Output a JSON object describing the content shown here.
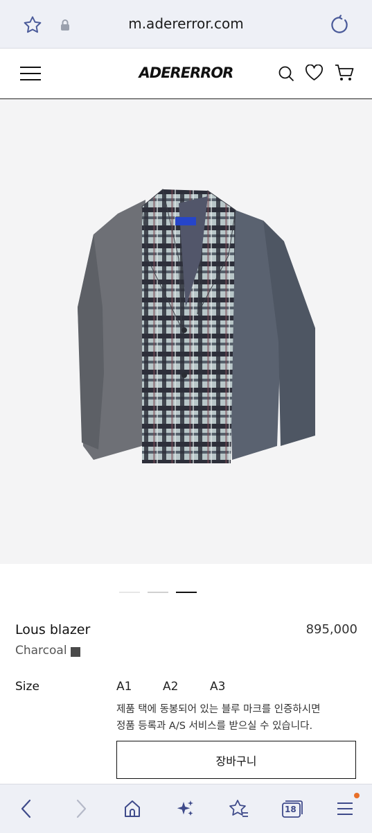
{
  "browser": {
    "url": "m.adererror.com",
    "icons": {
      "bookmark": "star-icon",
      "secure": "lock-icon",
      "reload": "reload-icon"
    },
    "tab_count": "18"
  },
  "header": {
    "logo": "ADERERROR",
    "icons": [
      "menu-icon",
      "search-icon",
      "heart-icon",
      "cart-icon"
    ]
  },
  "gallery": {
    "image_alt": "Lous blazer",
    "active_index": 3,
    "total": 3
  },
  "product": {
    "name": "Lous blazer",
    "price": "895,000",
    "color": "Charcoal",
    "color_hex": "#4a4a4a",
    "size_label": "Size",
    "sizes": [
      "A1",
      "A2",
      "A3"
    ],
    "notice_line1": "제품 택에 동봉되어 있는 블루 마크를 인증하시면",
    "notice_line2": "정품 등록과 A/S 서비스를 받으실 수 있습니다.",
    "cart_button": "장바구니"
  },
  "bottom_nav": {
    "notification_color": "#e8702a"
  }
}
